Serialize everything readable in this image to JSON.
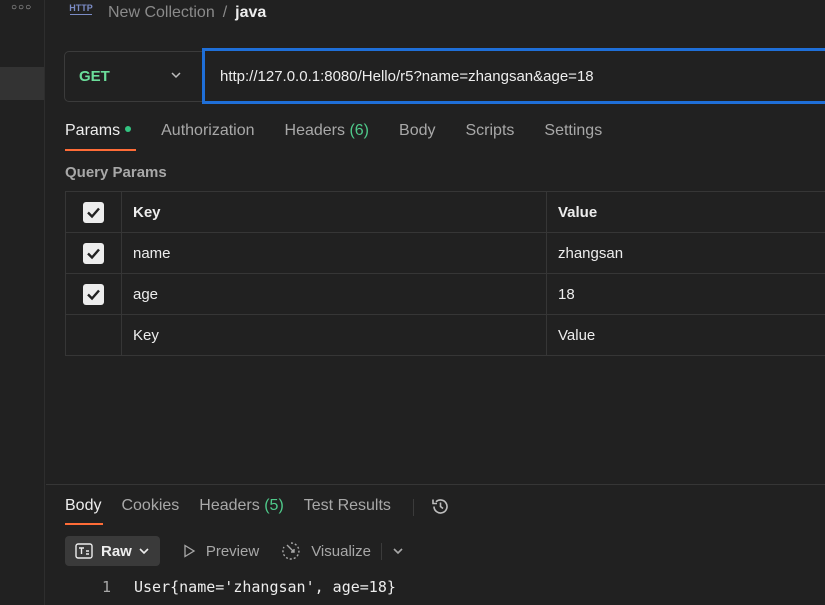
{
  "breadcrumb": {
    "icon": "http-icon",
    "icon_text": "HTTP",
    "collection": "New Collection",
    "separator": "/",
    "request": "java"
  },
  "request": {
    "method": "GET",
    "url": "http://127.0.0.1:8080/Hello/r5?name=zhangsan&age=18"
  },
  "tabs": [
    {
      "label": "Params",
      "active": true,
      "has_dot": true
    },
    {
      "label": "Authorization"
    },
    {
      "label": "Headers",
      "count": "(6)"
    },
    {
      "label": "Body"
    },
    {
      "label": "Scripts"
    },
    {
      "label": "Settings"
    }
  ],
  "query_params": {
    "title": "Query Params",
    "headers": {
      "key": "Key",
      "value": "Value"
    },
    "rows": [
      {
        "key": "name",
        "value": "zhangsan",
        "checked": true
      },
      {
        "key": "age",
        "value": "18",
        "checked": true
      }
    ],
    "placeholder": {
      "key": "Key",
      "value": "Value"
    }
  },
  "response": {
    "tabs": [
      {
        "label": "Body",
        "active": true
      },
      {
        "label": "Cookies"
      },
      {
        "label": "Headers",
        "count": "(5)"
      },
      {
        "label": "Test Results"
      }
    ],
    "format": {
      "selected": "Raw",
      "preview": "Preview",
      "visualize": "Visualize"
    },
    "lines": [
      {
        "number": "1",
        "text": "User{name='zhangsan', age=18}"
      }
    ]
  },
  "colors": {
    "accent_orange": "#ff6c37",
    "method_green": "#6bdd9a",
    "focus_blue": "#1f6fd8",
    "count_green": "#4fc98a"
  }
}
